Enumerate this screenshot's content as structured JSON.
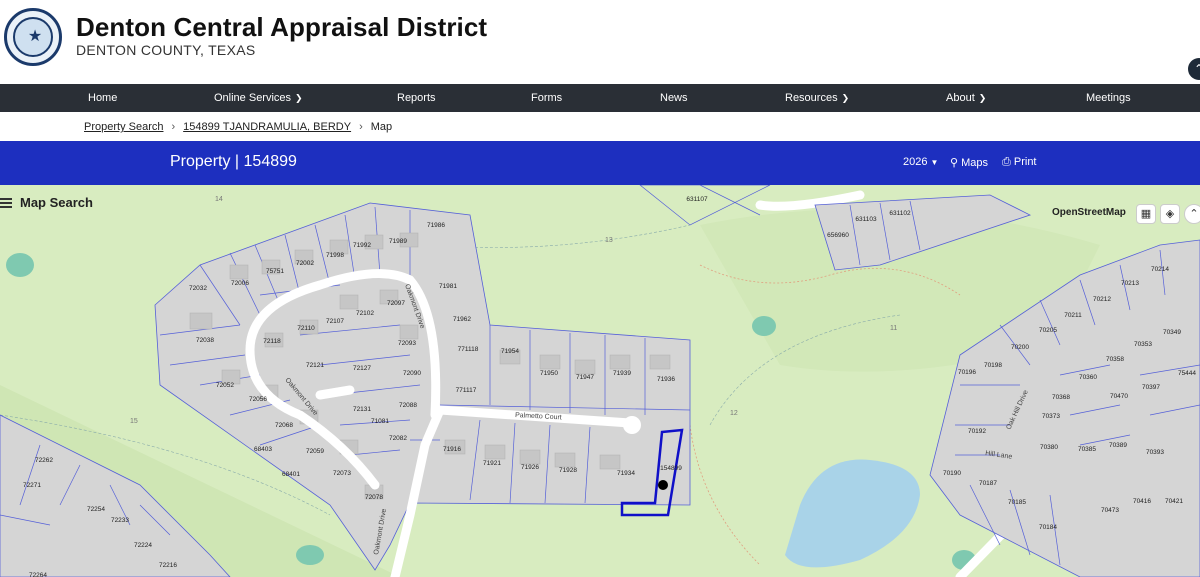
{
  "header": {
    "title": "Denton Central Appraisal District",
    "subtitle": "DENTON COUNTY, TEXAS",
    "logo_icon": "seal-logo"
  },
  "nav": {
    "items": [
      {
        "label": "Home",
        "has_menu": false
      },
      {
        "label": "Online Services",
        "has_menu": true
      },
      {
        "label": "Reports",
        "has_menu": false
      },
      {
        "label": "Forms",
        "has_menu": false
      },
      {
        "label": "News",
        "has_menu": false
      },
      {
        "label": "Resources",
        "has_menu": true
      },
      {
        "label": "About",
        "has_menu": true
      },
      {
        "label": "Meetings",
        "has_menu": false
      }
    ]
  },
  "breadcrumb": {
    "items": [
      "Property Search",
      "154899 TJANDRAMULIA, BERDY",
      "Map"
    ]
  },
  "property_bar": {
    "title": "Property | 154899",
    "year": "2026",
    "maps_label": "Maps",
    "print_label": "Print"
  },
  "map": {
    "search_label": "Map Search",
    "basemap_label": "OpenStreetMap",
    "streets": [
      "Oakmont Drive",
      "Oakmont Drive",
      "Palmetto Court",
      "Oakmont Drive",
      "Oak Hill Drive",
      "Hill Lane"
    ],
    "parcels": [
      "72032",
      "72006",
      "75751",
      "72002",
      "71998",
      "71992",
      "71989",
      "71986",
      "72038",
      "72118",
      "72110",
      "72107",
      "72102",
      "72097",
      "71981",
      "71962",
      "72052",
      "72121",
      "72127",
      "72093",
      "72090",
      "72056",
      "72131",
      "72088",
      "72068",
      "71081",
      "72082",
      "72059",
      "68403",
      "72073",
      "68401",
      "72078",
      "71954",
      "71950",
      "71947",
      "71939",
      "71936",
      "771118",
      "771117",
      "71916",
      "71921",
      "71926",
      "71928",
      "71934",
      "154899",
      "631107",
      "631103",
      "631102",
      "656960",
      "72262",
      "72271",
      "72254",
      "72233",
      "72224",
      "72216",
      "72264",
      "70214",
      "70213",
      "70212",
      "70211",
      "70205",
      "70349",
      "70200",
      "70353",
      "70358",
      "70198",
      "70196",
      "70360",
      "70397",
      "75444",
      "70368",
      "70373",
      "70470",
      "70192",
      "70380",
      "70385",
      "70389",
      "70393",
      "70190",
      "70187",
      "70185",
      "70184",
      "70473",
      "70416",
      "70421"
    ],
    "golf_numbers": [
      "14",
      "13",
      "11",
      "12",
      "15"
    ],
    "selected_parcel": "154899",
    "colors": {
      "parcel_line": "#5560d8",
      "selected": "#1010c8",
      "water": "#a9d3e8",
      "golf": "#d8ecc0"
    }
  }
}
